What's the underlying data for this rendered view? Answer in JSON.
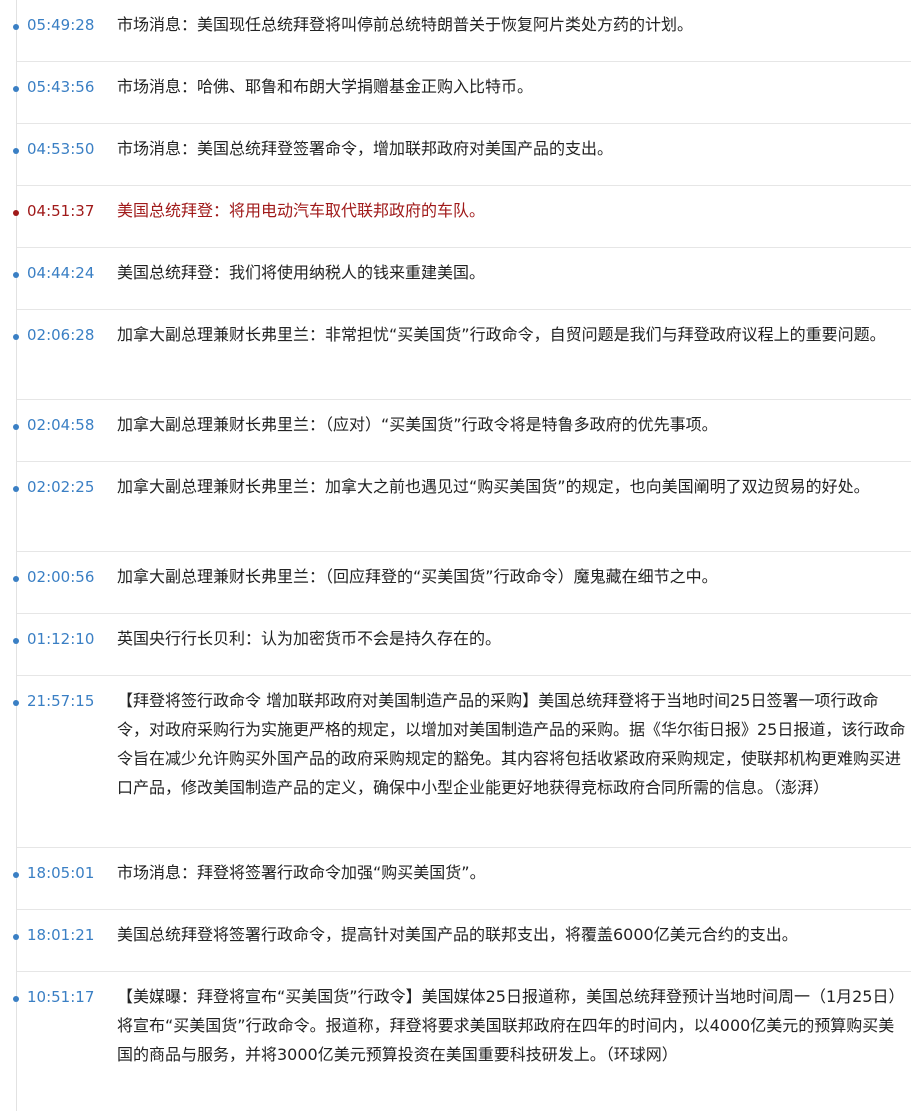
{
  "colors": {
    "time": "#3a7fc4",
    "important": "#a01a1a",
    "text": "#222222",
    "divider": "#e6e6e6"
  },
  "items": [
    {
      "time": "05:49:28",
      "text": "市场消息：美国现任总统拜登将叫停前总统特朗普关于恢复阿片类处方药的计划。",
      "important": false
    },
    {
      "time": "05:43:56",
      "text": "市场消息：哈佛、耶鲁和布朗大学捐赠基金正购入比特币。",
      "important": false
    },
    {
      "time": "04:53:50",
      "text": "市场消息：美国总统拜登签署命令，增加联邦政府对美国产品的支出。",
      "important": false
    },
    {
      "time": "04:51:37",
      "text": "美国总统拜登：将用电动汽车取代联邦政府的车队。",
      "important": true
    },
    {
      "time": "04:44:24",
      "text": "美国总统拜登：我们将使用纳税人的钱来重建美国。",
      "important": false
    },
    {
      "time": "02:06:28",
      "text": "加拿大副总理兼财长弗里兰：非常担忧“买美国货”行政命令，自贸问题是我们与拜登政府议程上的重要问题。",
      "important": false
    },
    {
      "time": "02:04:58",
      "text": "加拿大副总理兼财长弗里兰：（应对）“买美国货”行政令将是特鲁多政府的优先事项。",
      "important": false
    },
    {
      "time": "02:02:25",
      "text": "加拿大副总理兼财长弗里兰：加拿大之前也遇见过“购买美国货”的规定，也向美国阐明了双边贸易的好处。",
      "important": false
    },
    {
      "time": "02:00:56",
      "text": "加拿大副总理兼财长弗里兰：（回应拜登的“买美国货”行政命令）魔鬼藏在细节之中。",
      "important": false
    },
    {
      "time": "01:12:10",
      "text": "英国央行行长贝利：认为加密货币不会是持久存在的。",
      "important": false
    },
    {
      "time": "21:57:15",
      "text": "【拜登将签行政命令 增加联邦政府对美国制造产品的采购】美国总统拜登将于当地时间25日签署一项行政命令，对政府采购行为实施更严格的规定，以增加对美国制造产品的采购。据《华尔街日报》25日报道，该行政命令旨在减少允许购买外国产品的政府采购规定的豁免。其内容将包括收紧政府采购规定，使联邦机构更难购买进口产品，修改美国制造产品的定义，确保中小型企业能更好地获得竞标政府合同所需的信息。（澎湃）",
      "important": false
    },
    {
      "time": "18:05:01",
      "text": "市场消息：拜登将签署行政命令加强“购买美国货”。",
      "important": false
    },
    {
      "time": "18:01:21",
      "text": "美国总统拜登将签署行政命令，提高针对美国产品的联邦支出，将覆盖6000亿美元合约的支出。",
      "important": false
    },
    {
      "time": "10:51:17",
      "text": "【美媒曝：拜登将宣布“买美国货”行政令】美国媒体25日报道称，美国总统拜登预计当地时间周一（1月25日）将宣布“买美国货”行政命令。报道称，拜登将要求美国联邦政府在四年的时间内，以4000亿美元的预算购买美国的商品与服务，并将3000亿美元预算投资在美国重要科技研发上。（环球网）",
      "important": false
    }
  ]
}
